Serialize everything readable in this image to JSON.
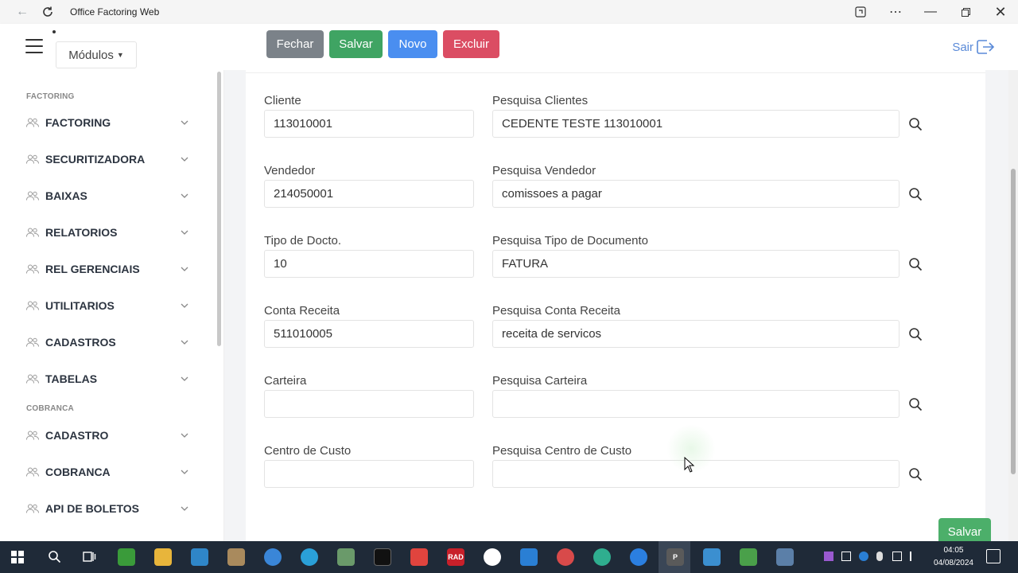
{
  "browser": {
    "title": "Office Factoring Web"
  },
  "header": {
    "modulos_label": "Módulos",
    "buttons": {
      "fechar": "Fechar",
      "salvar": "Salvar",
      "novo": "Novo",
      "excluir": "Excluir"
    },
    "sair_label": "Sair"
  },
  "sidebar": {
    "sections": [
      "FACTORING",
      "COBRANCA"
    ],
    "items": [
      {
        "label": "FACTORING"
      },
      {
        "label": "SECURITIZADORA"
      },
      {
        "label": "BAIXAS"
      },
      {
        "label": "RELATORIOS"
      },
      {
        "label": "REL GERENCIAIS"
      },
      {
        "label": "UTILITARIOS"
      },
      {
        "label": "CADASTROS"
      },
      {
        "label": "TABELAS"
      },
      {
        "label": "CADASTRO"
      },
      {
        "label": "COBRANCA"
      },
      {
        "label": "API DE BOLETOS"
      }
    ]
  },
  "form": {
    "fields": [
      {
        "label": "Cliente",
        "value": "113010001",
        "search_label": "Pesquisa Clientes",
        "search_value": "CEDENTE TESTE 113010001"
      },
      {
        "label": "Vendedor",
        "value": "214050001",
        "search_label": "Pesquisa Vendedor",
        "search_value": "comissoes a pagar"
      },
      {
        "label": "Tipo de Docto.",
        "value": "10",
        "search_label": "Pesquisa Tipo de Documento",
        "search_value": "FATURA"
      },
      {
        "label": "Conta Receita",
        "value": "511010005",
        "search_label": "Pesquisa Conta Receita",
        "search_value": "receita de servicos"
      },
      {
        "label": "Carteira",
        "value": "",
        "search_label": "Pesquisa Carteira",
        "search_value": ""
      },
      {
        "label": "Centro de Custo",
        "value": "",
        "search_label": "Pesquisa Centro de Custo",
        "search_value": ""
      }
    ],
    "save_label": "Salvar"
  },
  "taskbar": {
    "time": "04:05",
    "date": "04/08/2024",
    "apps": [
      "RAD",
      "P"
    ]
  }
}
